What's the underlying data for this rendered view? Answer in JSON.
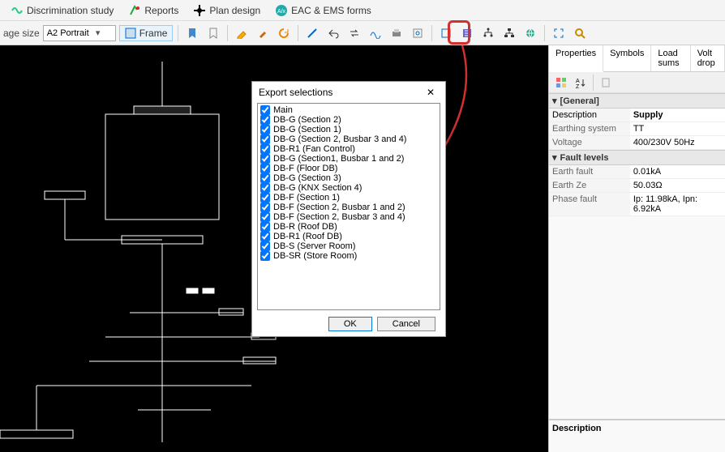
{
  "top_tabs": [
    {
      "label": "Discrimination study"
    },
    {
      "label": "Reports"
    },
    {
      "label": "Plan design"
    },
    {
      "label": "EAC & EMS forms"
    }
  ],
  "toolbar": {
    "page_size_label": "age size",
    "page_size_value": "A2 Portrait",
    "frame_label": "Frame"
  },
  "dialog": {
    "title": "Export selections",
    "ok": "OK",
    "cancel": "Cancel",
    "items": [
      "Main",
      "DB-G (Section 2)",
      "DB-G (Section 1)",
      "DB-G (Section 2, Busbar 3 and 4)",
      "DB-R1 (Fan Control)",
      "DB-G (Section1, Busbar 1 and 2)",
      "DB-F (Floor DB)",
      "DB-G (Section 3)",
      "DB-G (KNX Section 4)",
      "DB-F (Section 1)",
      "DB-F (Section 2, Busbar 1 and 2)",
      "DB-F (Section 2, Busbar 3 and 4)",
      "DB-R (Roof DB)",
      "DB-R1 (Roof DB)",
      "DB-S (Server Room)",
      "DB-SR (Store Room)"
    ]
  },
  "side": {
    "tabs": [
      "Properties",
      "Symbols",
      "Load sums",
      "Volt drop"
    ],
    "cat1": "[General]",
    "cat2": "Fault levels",
    "rows": {
      "desc_k": "Description",
      "desc_v": "Supply",
      "earth_k": "Earthing system",
      "earth_v": "TT",
      "volt_k": "Voltage",
      "volt_v": "400/230V 50Hz",
      "ef_k": "Earth fault",
      "ef_v": "0.01kA",
      "ez_k": "Earth Ze",
      "ez_v": "50.03Ω",
      "pf_k": "Phase fault",
      "pf_v": "Ip: 11.98kA, Ipn: 6.92kA"
    },
    "desc_title": "Description"
  }
}
